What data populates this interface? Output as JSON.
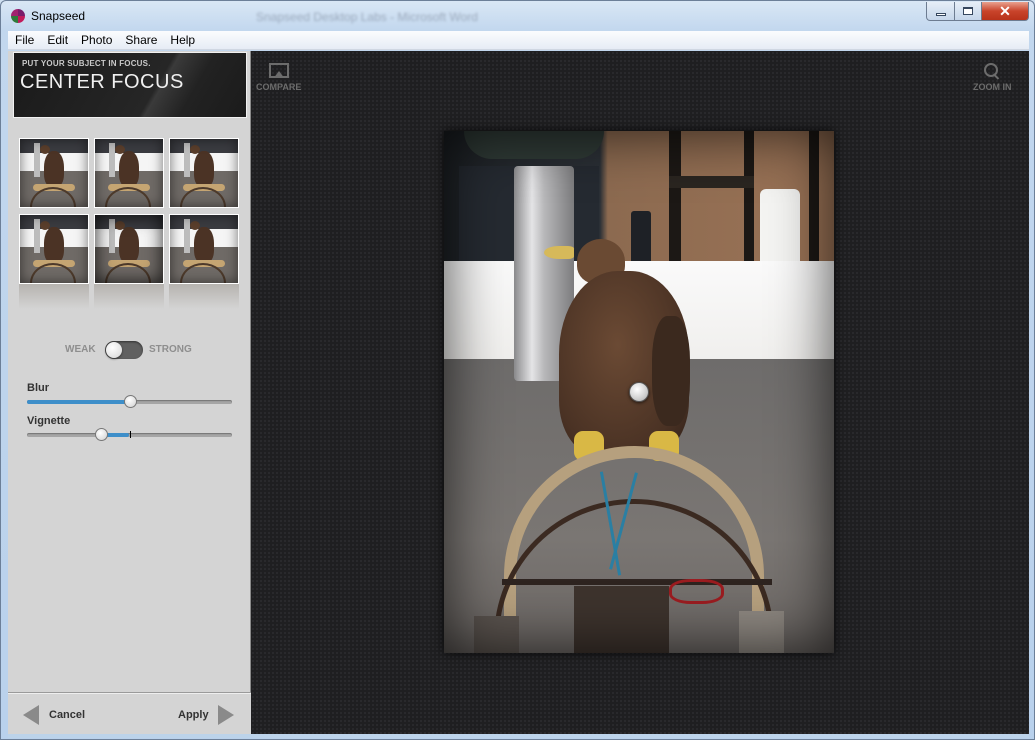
{
  "window": {
    "title": "Snapseed",
    "background_title": "Snapseed Desktop Labs - Microsoft Word",
    "controls": {
      "minimize": "minimize",
      "maximize": "maximize",
      "close": "✕"
    }
  },
  "menu": [
    "File",
    "Edit",
    "Photo",
    "Share",
    "Help"
  ],
  "panel": {
    "subtitle": "PUT YOUR SUBJECT IN FOCUS.",
    "title": "CENTER FOCUS",
    "presets": [
      {
        "name": "preset-1"
      },
      {
        "name": "preset-2"
      },
      {
        "name": "preset-3"
      },
      {
        "name": "preset-4"
      },
      {
        "name": "preset-5"
      },
      {
        "name": "preset-6"
      }
    ],
    "toggle": {
      "left_label": "WEAK",
      "right_label": "STRONG",
      "state": "WEAK"
    },
    "sliders": [
      {
        "label": "Blur",
        "value": 0.5,
        "default": 0.0
      },
      {
        "label": "Vignette",
        "value": 0.36,
        "default": 0.5
      }
    ],
    "footer": {
      "cancel": "Cancel",
      "apply": "Apply"
    }
  },
  "stage": {
    "compare": "COMPARE",
    "zoom_in": "ZOOM IN"
  },
  "colors": {
    "accent": "#3d8ec9",
    "panel_bg": "#d4d4d4",
    "stage_bg": "#1f1f21"
  }
}
